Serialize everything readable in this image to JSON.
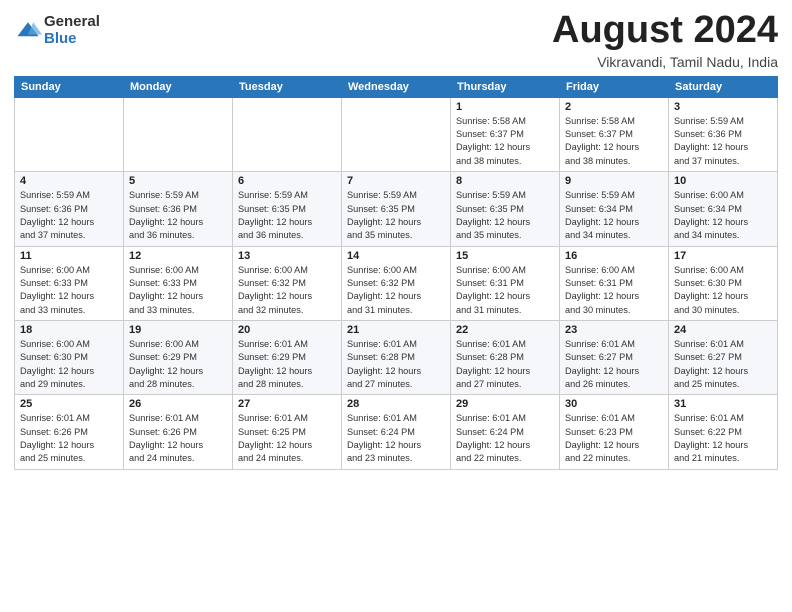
{
  "header": {
    "logo_general": "General",
    "logo_blue": "Blue",
    "month_title": "August 2024",
    "subtitle": "Vikravandi, Tamil Nadu, India"
  },
  "calendar": {
    "weekdays": [
      "Sunday",
      "Monday",
      "Tuesday",
      "Wednesday",
      "Thursday",
      "Friday",
      "Saturday"
    ],
    "rows": [
      [
        {
          "day": "",
          "info": ""
        },
        {
          "day": "",
          "info": ""
        },
        {
          "day": "",
          "info": ""
        },
        {
          "day": "",
          "info": ""
        },
        {
          "day": "1",
          "info": "Sunrise: 5:58 AM\nSunset: 6:37 PM\nDaylight: 12 hours\nand 38 minutes."
        },
        {
          "day": "2",
          "info": "Sunrise: 5:58 AM\nSunset: 6:37 PM\nDaylight: 12 hours\nand 38 minutes."
        },
        {
          "day": "3",
          "info": "Sunrise: 5:59 AM\nSunset: 6:36 PM\nDaylight: 12 hours\nand 37 minutes."
        }
      ],
      [
        {
          "day": "4",
          "info": "Sunrise: 5:59 AM\nSunset: 6:36 PM\nDaylight: 12 hours\nand 37 minutes."
        },
        {
          "day": "5",
          "info": "Sunrise: 5:59 AM\nSunset: 6:36 PM\nDaylight: 12 hours\nand 36 minutes."
        },
        {
          "day": "6",
          "info": "Sunrise: 5:59 AM\nSunset: 6:35 PM\nDaylight: 12 hours\nand 36 minutes."
        },
        {
          "day": "7",
          "info": "Sunrise: 5:59 AM\nSunset: 6:35 PM\nDaylight: 12 hours\nand 35 minutes."
        },
        {
          "day": "8",
          "info": "Sunrise: 5:59 AM\nSunset: 6:35 PM\nDaylight: 12 hours\nand 35 minutes."
        },
        {
          "day": "9",
          "info": "Sunrise: 5:59 AM\nSunset: 6:34 PM\nDaylight: 12 hours\nand 34 minutes."
        },
        {
          "day": "10",
          "info": "Sunrise: 6:00 AM\nSunset: 6:34 PM\nDaylight: 12 hours\nand 34 minutes."
        }
      ],
      [
        {
          "day": "11",
          "info": "Sunrise: 6:00 AM\nSunset: 6:33 PM\nDaylight: 12 hours\nand 33 minutes."
        },
        {
          "day": "12",
          "info": "Sunrise: 6:00 AM\nSunset: 6:33 PM\nDaylight: 12 hours\nand 33 minutes."
        },
        {
          "day": "13",
          "info": "Sunrise: 6:00 AM\nSunset: 6:32 PM\nDaylight: 12 hours\nand 32 minutes."
        },
        {
          "day": "14",
          "info": "Sunrise: 6:00 AM\nSunset: 6:32 PM\nDaylight: 12 hours\nand 31 minutes."
        },
        {
          "day": "15",
          "info": "Sunrise: 6:00 AM\nSunset: 6:31 PM\nDaylight: 12 hours\nand 31 minutes."
        },
        {
          "day": "16",
          "info": "Sunrise: 6:00 AM\nSunset: 6:31 PM\nDaylight: 12 hours\nand 30 minutes."
        },
        {
          "day": "17",
          "info": "Sunrise: 6:00 AM\nSunset: 6:30 PM\nDaylight: 12 hours\nand 30 minutes."
        }
      ],
      [
        {
          "day": "18",
          "info": "Sunrise: 6:00 AM\nSunset: 6:30 PM\nDaylight: 12 hours\nand 29 minutes."
        },
        {
          "day": "19",
          "info": "Sunrise: 6:00 AM\nSunset: 6:29 PM\nDaylight: 12 hours\nand 28 minutes."
        },
        {
          "day": "20",
          "info": "Sunrise: 6:01 AM\nSunset: 6:29 PM\nDaylight: 12 hours\nand 28 minutes."
        },
        {
          "day": "21",
          "info": "Sunrise: 6:01 AM\nSunset: 6:28 PM\nDaylight: 12 hours\nand 27 minutes."
        },
        {
          "day": "22",
          "info": "Sunrise: 6:01 AM\nSunset: 6:28 PM\nDaylight: 12 hours\nand 27 minutes."
        },
        {
          "day": "23",
          "info": "Sunrise: 6:01 AM\nSunset: 6:27 PM\nDaylight: 12 hours\nand 26 minutes."
        },
        {
          "day": "24",
          "info": "Sunrise: 6:01 AM\nSunset: 6:27 PM\nDaylight: 12 hours\nand 25 minutes."
        }
      ],
      [
        {
          "day": "25",
          "info": "Sunrise: 6:01 AM\nSunset: 6:26 PM\nDaylight: 12 hours\nand 25 minutes."
        },
        {
          "day": "26",
          "info": "Sunrise: 6:01 AM\nSunset: 6:26 PM\nDaylight: 12 hours\nand 24 minutes."
        },
        {
          "day": "27",
          "info": "Sunrise: 6:01 AM\nSunset: 6:25 PM\nDaylight: 12 hours\nand 24 minutes."
        },
        {
          "day": "28",
          "info": "Sunrise: 6:01 AM\nSunset: 6:24 PM\nDaylight: 12 hours\nand 23 minutes."
        },
        {
          "day": "29",
          "info": "Sunrise: 6:01 AM\nSunset: 6:24 PM\nDaylight: 12 hours\nand 22 minutes."
        },
        {
          "day": "30",
          "info": "Sunrise: 6:01 AM\nSunset: 6:23 PM\nDaylight: 12 hours\nand 22 minutes."
        },
        {
          "day": "31",
          "info": "Sunrise: 6:01 AM\nSunset: 6:22 PM\nDaylight: 12 hours\nand 21 minutes."
        }
      ]
    ]
  }
}
